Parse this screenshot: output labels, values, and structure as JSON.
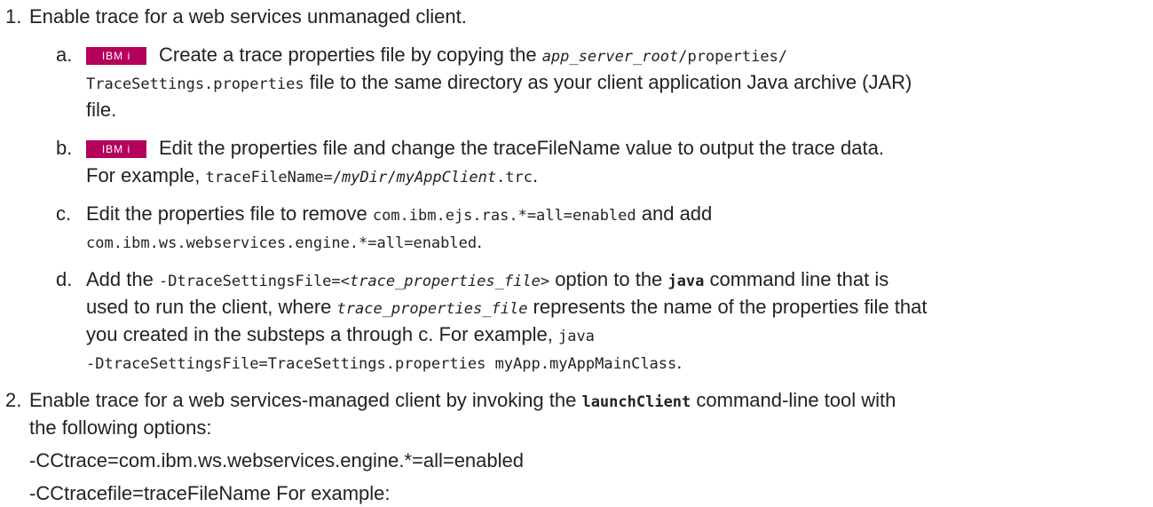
{
  "badge_label": "IBM i",
  "step1": {
    "number": "1.",
    "text": "Enable trace for a web services unmanaged client.",
    "a": {
      "letter": "a.",
      "t1": "Create a trace properties file by copying the ",
      "t2": "app_server_root",
      "t3": "/properties/",
      "t4": "TraceSettings.properties",
      "t5": " file to the same directory as your client application Java archive (JAR)",
      "t6": "file."
    },
    "b": {
      "letter": "b.",
      "t1": "Edit the properties file and change the traceFileName value to output the trace data.",
      "t2": "For example, ",
      "t3": "traceFileName=/",
      "t4": "myDir",
      "t5": "/",
      "t6": "myAppClient",
      "t7": ".trc",
      "t8": "."
    },
    "c": {
      "letter": "c.",
      "t1": "Edit the properties file to remove ",
      "t2": "com.ibm.ejs.ras.*=all=enabled",
      "t3": " and add",
      "t4": "com.ibm.ws.webservices.engine.*=all=enabled",
      "t5": "."
    },
    "d": {
      "letter": "d.",
      "t1": "Add the ",
      "t2": "-DtraceSettingsFile=<",
      "t3": "trace_properties_file",
      "t4": ">",
      "t5": " option to the ",
      "t6": "java",
      "t7": " command line that is",
      "t8": "used to run the client, where ",
      "t9": "trace_properties_file",
      "t10": " represents the name of the properties file that",
      "t11": "you created in the substeps a through c. For example, ",
      "t12": "java",
      "t13": "-DtraceSettingsFile=TraceSettings.properties myApp.myAppMainClass",
      "t14": "."
    }
  },
  "step2": {
    "number": "2.",
    "t1": "Enable trace for a web services-managed client by invoking the ",
    "t2": "launchClient",
    "t3": " command-line tool with",
    "t4": "the following options:",
    "opt1": "-CCtrace=com.ibm.ws.webservices.engine.*=all=enabled",
    "opt2": "-CCtracefile=traceFileName For example:"
  }
}
